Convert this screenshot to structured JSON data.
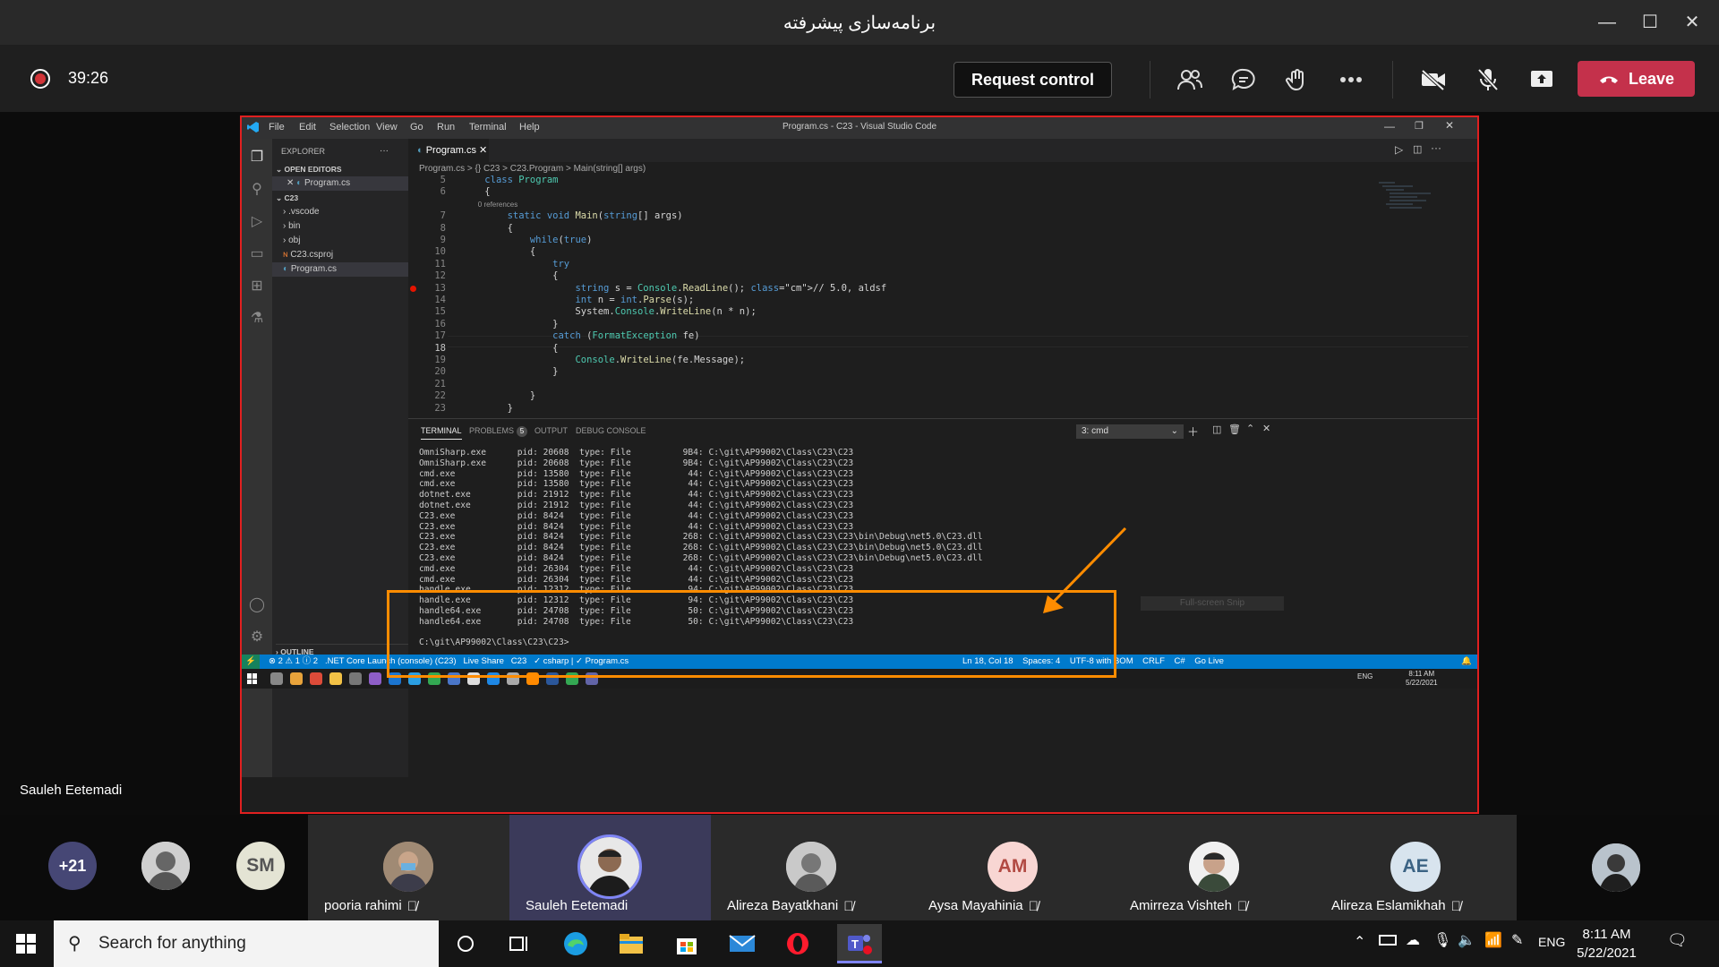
{
  "window": {
    "title": "برنامه‌سازی پیشرفته"
  },
  "toolbar": {
    "timer": "39:26",
    "request_control": "Request control",
    "leave": "Leave"
  },
  "presenter": {
    "name": "Sauleh Eetemadi"
  },
  "vscode": {
    "menu": [
      "File",
      "Edit",
      "Selection",
      "View",
      "Go",
      "Run",
      "Terminal",
      "Help"
    ],
    "window_title": "Program.cs - C23 - Visual Studio Code",
    "explorer": {
      "header": "EXPLORER",
      "open_editors": "OPEN EDITORS",
      "open_file": "Program.cs",
      "folder": "C23",
      "items": [
        ".vscode",
        "bin",
        "obj",
        "C23.csproj",
        "Program.cs"
      ],
      "outline": "OUTLINE"
    },
    "tab": "Program.cs",
    "breadcrumb": "Program.cs > {} C23 > C23.Program > Main(string[] args)",
    "code": [
      {
        "n": "5",
        "t": "    class Program"
      },
      {
        "n": "6",
        "t": "    {"
      },
      {
        "n": "",
        "t": "        0 references"
      },
      {
        "n": "7",
        "t": "        static void Main(string[] args)"
      },
      {
        "n": "8",
        "t": "        {"
      },
      {
        "n": "9",
        "t": "            while(true)"
      },
      {
        "n": "10",
        "t": "            {"
      },
      {
        "n": "11",
        "t": "                try"
      },
      {
        "n": "12",
        "t": "                {"
      },
      {
        "n": "13",
        "t": "                    string s = Console.ReadLine(); // 5.0, aldsf"
      },
      {
        "n": "14",
        "t": "                    int n = int.Parse(s);"
      },
      {
        "n": "15",
        "t": "                    System.Console.WriteLine(n * n);"
      },
      {
        "n": "16",
        "t": "                }"
      },
      {
        "n": "17",
        "t": "                catch (FormatException fe)"
      },
      {
        "n": "18",
        "t": "                {"
      },
      {
        "n": "19",
        "t": "                    Console.WriteLine(fe.Message);"
      },
      {
        "n": "20",
        "t": "                }"
      },
      {
        "n": "21",
        "t": ""
      },
      {
        "n": "22",
        "t": "            }"
      },
      {
        "n": "23",
        "t": "        }"
      }
    ],
    "panel_tabs": [
      "TERMINAL",
      "PROBLEMS",
      "OUTPUT",
      "DEBUG CONSOLE"
    ],
    "problems_count": "5",
    "terminal_select": "3: cmd",
    "terminal_lines": [
      "OmniSharp.exe      pid: 20608  type: File          9B4: C:\\git\\AP99002\\Class\\C23\\C23",
      "OmniSharp.exe      pid: 20608  type: File          9B4: C:\\git\\AP99002\\Class\\C23\\C23",
      "cmd.exe            pid: 13580  type: File           44: C:\\git\\AP99002\\Class\\C23\\C23",
      "cmd.exe            pid: 13580  type: File           44: C:\\git\\AP99002\\Class\\C23\\C23",
      "dotnet.exe         pid: 21912  type: File           44: C:\\git\\AP99002\\Class\\C23\\C23",
      "dotnet.exe         pid: 21912  type: File           44: C:\\git\\AP99002\\Class\\C23\\C23",
      "C23.exe            pid: 8424   type: File           44: C:\\git\\AP99002\\Class\\C23\\C23",
      "C23.exe            pid: 8424   type: File           44: C:\\git\\AP99002\\Class\\C23\\C23",
      "C23.exe            pid: 8424   type: File          268: C:\\git\\AP99002\\Class\\C23\\C23\\bin\\Debug\\net5.0\\C23.dll",
      "C23.exe            pid: 8424   type: File          268: C:\\git\\AP99002\\Class\\C23\\C23\\bin\\Debug\\net5.0\\C23.dll",
      "C23.exe            pid: 8424   type: File          268: C:\\git\\AP99002\\Class\\C23\\C23\\bin\\Debug\\net5.0\\C23.dll",
      "cmd.exe            pid: 26304  type: File           44: C:\\git\\AP99002\\Class\\C23\\C23",
      "cmd.exe            pid: 26304  type: File           44: C:\\git\\AP99002\\Class\\C23\\C23",
      "handle.exe         pid: 12312  type: File           94: C:\\git\\AP99002\\Class\\C23\\C23",
      "handle.exe         pid: 12312  type: File           94: C:\\git\\AP99002\\Class\\C23\\C23",
      "handle64.exe       pid: 24708  type: File           50: C:\\git\\AP99002\\Class\\C23\\C23",
      "handle64.exe       pid: 24708  type: File           50: C:\\git\\AP99002\\Class\\C23\\C23",
      "",
      "C:\\git\\AP99002\\Class\\C23\\C23>"
    ],
    "status_left": "⊗ 2 ⚠ 1 ⓘ 2   .NET Core Launch (console) (C23)   Live Share   C23   ✓ csharp | ✓ Program.cs",
    "status_right": "Ln 18, Col 18    Spaces: 4    UTF-8 with BOM    CRLF    C#    Go Live",
    "inner_clock": "8:11 AM",
    "inner_date": "5/22/2021",
    "inner_lang": "ENG",
    "overlay_hint": "Full-screen Snip"
  },
  "participants": {
    "overflow": "+21",
    "initials_sm": "SM",
    "people": [
      {
        "name": "pooria rahimi"
      },
      {
        "name": "Sauleh Eetemadi"
      },
      {
        "name": "Alireza Bayatkhani"
      },
      {
        "name": "Aysa Mayahinia",
        "initials": "AM"
      },
      {
        "name": "Amirreza Vishteh"
      },
      {
        "name": "Alireza Eslamikhah",
        "initials": "AE"
      }
    ]
  },
  "taskbar": {
    "search_placeholder": "Search for anything",
    "lang": "ENG",
    "time": "8:11 AM",
    "date": "5/22/2021"
  },
  "colors": {
    "leave": "#c4314b",
    "vscode_status": "#007acc",
    "highlight_box": "#ff8c00",
    "share_border": "#e02020"
  }
}
